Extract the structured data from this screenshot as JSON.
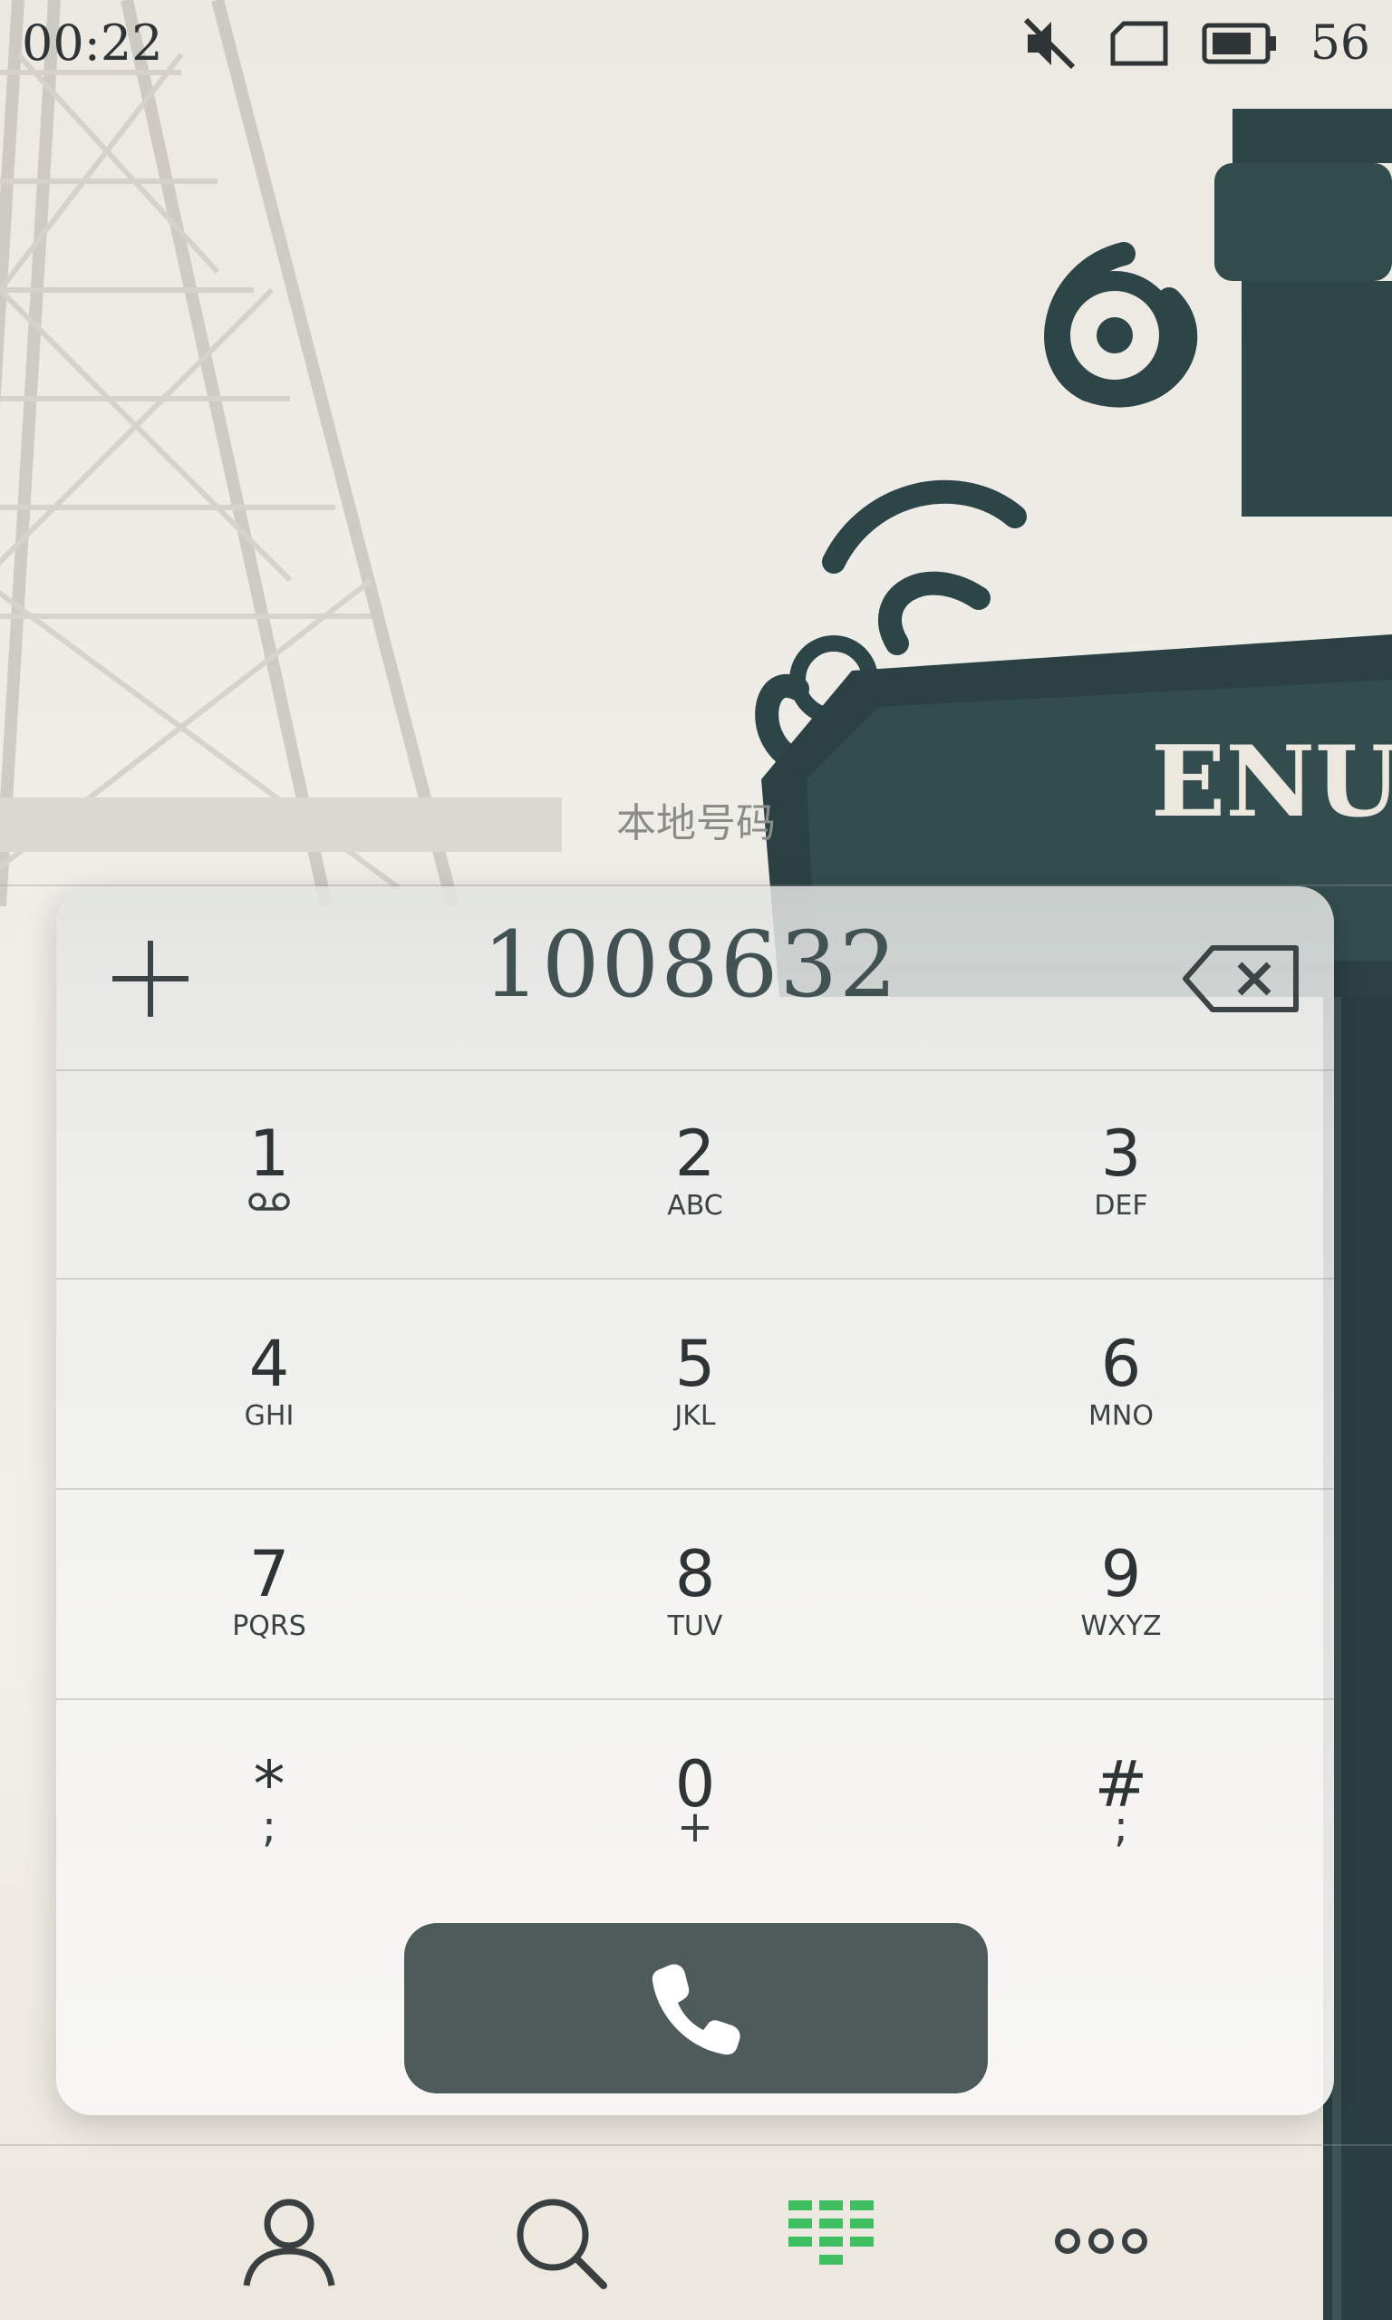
{
  "status_bar": {
    "time": "00:22",
    "battery_level": "56",
    "icons": [
      "mute-icon",
      "sim-card-icon",
      "battery-icon"
    ]
  },
  "local_number_label": "本地号码",
  "dialer": {
    "number": "1008632",
    "add_icon": "add-icon",
    "backspace_icon": "backspace-icon",
    "number_color": "#425253",
    "keys": [
      [
        {
          "digit": "1",
          "letters": "",
          "icon": "voicemail-icon"
        },
        {
          "digit": "2",
          "letters": "ABC"
        },
        {
          "digit": "3",
          "letters": "DEF"
        }
      ],
      [
        {
          "digit": "4",
          "letters": "GHI"
        },
        {
          "digit": "5",
          "letters": "JKL"
        },
        {
          "digit": "6",
          "letters": "MNO"
        }
      ],
      [
        {
          "digit": "7",
          "letters": "PQRS"
        },
        {
          "digit": "8",
          "letters": "TUV"
        },
        {
          "digit": "9",
          "letters": "WXYZ"
        }
      ],
      [
        {
          "digit": "*",
          "letters": ";"
        },
        {
          "digit": "0",
          "letters": "+"
        },
        {
          "digit": "#",
          "letters": ";"
        }
      ]
    ],
    "call_button": {
      "icon": "phone-icon",
      "color": "#4f5b5b"
    }
  },
  "bottom_nav": {
    "items": [
      {
        "id": "contacts",
        "icon": "person-icon",
        "active": false
      },
      {
        "id": "search",
        "icon": "search-icon",
        "active": false
      },
      {
        "id": "dialpad",
        "icon": "dialpad-icon",
        "active": true
      },
      {
        "id": "more",
        "icon": "more-icon",
        "active": false
      }
    ],
    "active_color": "#3fbf62",
    "inactive_color": "#3a3f41"
  }
}
